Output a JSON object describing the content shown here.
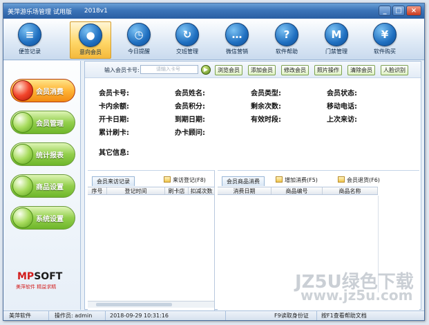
{
  "window": {
    "title": "美萍游乐场管理 试用版",
    "version": "2018v1",
    "buttons": {
      "minimize": "_",
      "maximize": "□",
      "close": "×"
    }
  },
  "toolbar": {
    "items": [
      {
        "label": "便签记录",
        "icon": "notepad-icon",
        "glyph": "≡",
        "active": false
      },
      {
        "label": "意向会员",
        "icon": "member-icon",
        "glyph": "●",
        "active": true
      },
      {
        "label": "今日提醒",
        "icon": "clock-icon",
        "glyph": "◷",
        "active": false
      },
      {
        "label": "交班管理",
        "icon": "refresh-icon",
        "glyph": "↻",
        "active": false
      },
      {
        "label": "微信营销",
        "icon": "chat-icon",
        "glyph": "…",
        "active": false
      },
      {
        "label": "软件帮助",
        "icon": "help-icon",
        "glyph": "?",
        "active": false
      },
      {
        "label": "门禁管理",
        "icon": "gate-icon",
        "glyph": "M",
        "active": false
      },
      {
        "label": "软件购买",
        "icon": "yen-icon",
        "glyph": "¥",
        "active": false
      }
    ]
  },
  "sidebar": {
    "items": [
      {
        "label": "会员消费",
        "active": true
      },
      {
        "label": "会员管理",
        "active": false
      },
      {
        "label": "统计报表",
        "active": false
      },
      {
        "label": "商品设置",
        "active": false
      },
      {
        "label": "系统设置",
        "active": false
      }
    ],
    "logo_mp": "MP",
    "logo_soft": "SOFT",
    "logo_sub": "美萍软件 精益求精"
  },
  "search": {
    "label": "输入会员卡号:",
    "placeholder": "请输入卡号",
    "buttons": [
      "浏览会员",
      "添加会员",
      "修改会员",
      "照片操作",
      "清除会员",
      "人脸识别"
    ]
  },
  "info": {
    "rows": [
      [
        "会员卡号:",
        "会员姓名:",
        "会员类型:",
        "会员状态:"
      ],
      [
        "卡内余额:",
        "会员积分:",
        "剩余次数:",
        "移动电话:"
      ],
      [
        "开卡日期:",
        "到期日期:",
        "有效时段:",
        "上次来访:"
      ],
      [
        "累计刷卡:",
        "办卡顾问:"
      ]
    ],
    "other": "其它信息:"
  },
  "visit_panel": {
    "tab": "会员来访记录",
    "action": "来访登记(F8)",
    "columns": [
      "序号",
      "登记时间",
      "刷卡店",
      "扣减次数"
    ]
  },
  "goods_panel": {
    "tab": "会员商品消费",
    "actions": [
      "增加消费(F5)",
      "会员退货(F6)"
    ],
    "columns": [
      "消费日期",
      "商品编号",
      "商品名称"
    ]
  },
  "statusbar": {
    "company": "美萍软件",
    "operator": "操作员: admin",
    "datetime": "2018-09-29 10:31:16",
    "id_reader": "F9读取身份证",
    "help": "按F1查看帮助文档"
  },
  "watermark": {
    "line1": "JZ5U绿色下载",
    "line2": "www.jz5u.com"
  }
}
